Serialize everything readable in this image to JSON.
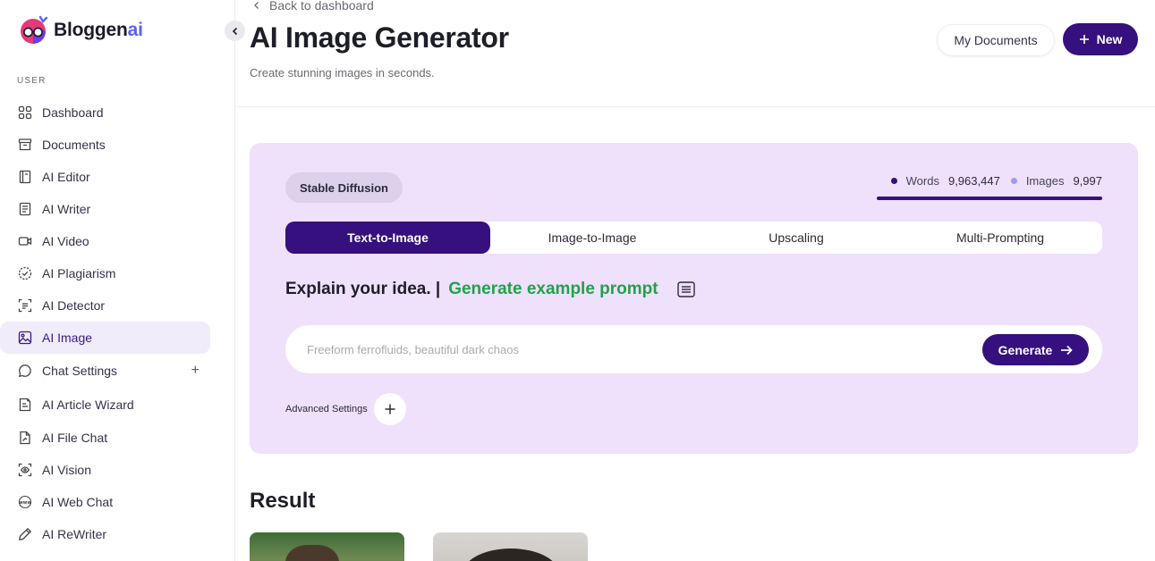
{
  "brand": {
    "name_main": "Bloggen",
    "name_ai": "ai",
    "accent": "#5b61f5"
  },
  "sidebar": {
    "section_label": "USER",
    "items": [
      {
        "label": "Dashboard",
        "icon": "grid-icon"
      },
      {
        "label": "Documents",
        "icon": "archive-icon"
      },
      {
        "label": "AI Editor",
        "icon": "book-icon"
      },
      {
        "label": "AI Writer",
        "icon": "document-icon"
      },
      {
        "label": "AI Video",
        "icon": "video-icon"
      },
      {
        "label": "AI Plagiarism",
        "icon": "badge-check-icon"
      },
      {
        "label": "AI Detector",
        "icon": "scan-text-icon"
      },
      {
        "label": "AI Image",
        "icon": "image-icon",
        "active": true
      },
      {
        "label": "Chat Settings",
        "icon": "chat-bubble-icon",
        "expandable": true,
        "expand_symbol": "+"
      },
      {
        "label": "AI Article Wizard",
        "icon": "article-icon"
      },
      {
        "label": "AI File Chat",
        "icon": "file-icon"
      },
      {
        "label": "AI Vision",
        "icon": "eye-scan-icon"
      },
      {
        "label": "AI Web Chat",
        "icon": "www-icon"
      },
      {
        "label": "AI ReWriter",
        "icon": "pen-icon"
      }
    ]
  },
  "header": {
    "back_label": "Back to dashboard",
    "title": "AI Image Generator",
    "subtitle": "Create stunning images in seconds.",
    "my_documents_label": "My Documents",
    "new_label": "New"
  },
  "generator": {
    "model_badge": "Stable Diffusion",
    "stats": {
      "words_label": "Words",
      "words_value": "9,963,447",
      "images_label": "Images",
      "images_value": "9,997",
      "words_color": "#35107e",
      "images_color": "#9b9cf0"
    },
    "tabs": [
      {
        "label": "Text-to-Image",
        "active": true
      },
      {
        "label": "Image-to-Image",
        "active": false
      },
      {
        "label": "Upscaling",
        "active": false
      },
      {
        "label": "Multi-Prompting",
        "active": false
      }
    ],
    "idea_label": "Explain your idea. |",
    "example_prompt_link": "Generate example prompt",
    "prompt_placeholder": "Freeform ferrofluids, beautiful dark chaos",
    "prompt_value": "",
    "generate_label": "Generate",
    "advanced_label": "Advanced Settings"
  },
  "result": {
    "title": "Result"
  },
  "colors": {
    "primary": "#35107e",
    "panel_bg": "#efe0fb",
    "link_green": "#21a24a",
    "active_nav_bg": "#f1ecfa"
  }
}
